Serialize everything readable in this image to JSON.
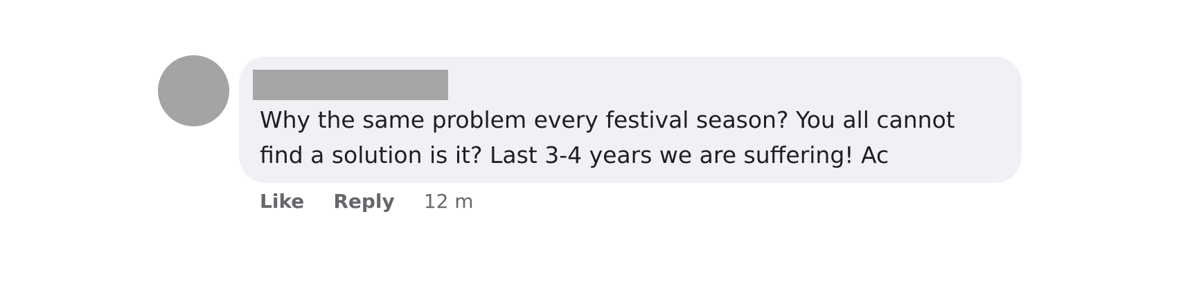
{
  "comment": {
    "text": "Why the same problem every festival season? You all cannot find a solution is it? Last 3-4 years we are suffering! Ac",
    "actions": {
      "like_label": "Like",
      "reply_label": "Reply",
      "timestamp": "12 m"
    }
  }
}
